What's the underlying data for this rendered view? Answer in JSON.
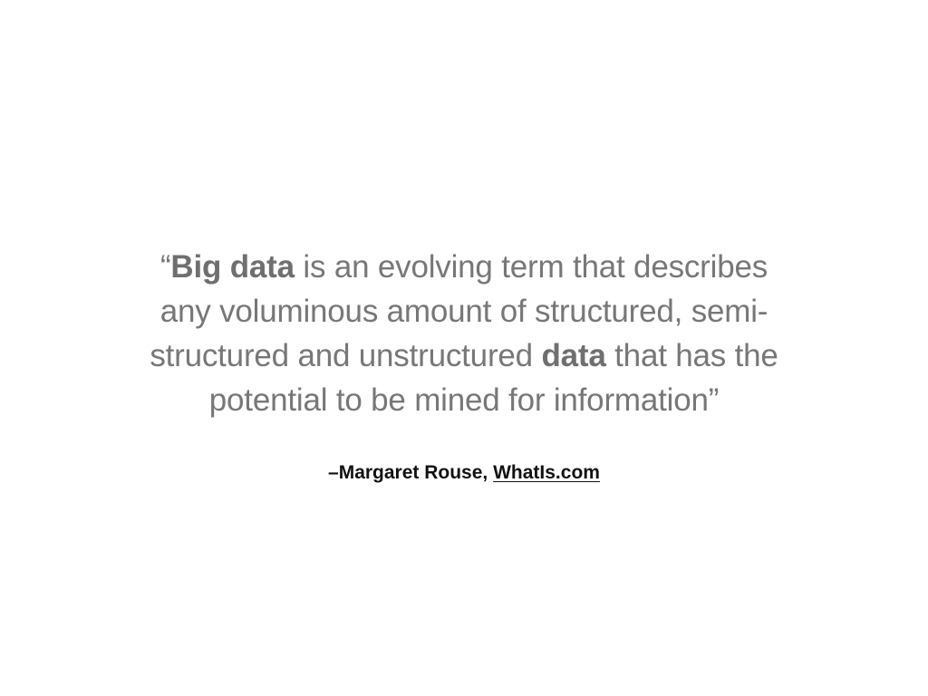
{
  "quote": {
    "line1": {
      "open_mark": "“",
      "bold": "Big data",
      "rest": " is an evolving term that describes"
    },
    "line2": "any voluminous amount of structured, semi-",
    "line3": {
      "before": "structured and unstructured ",
      "bold": "data",
      "after": " that has the"
    },
    "line4": "potential to be mined for information”"
  },
  "attribution": {
    "author": "–Margaret Rouse, ",
    "source_link": "WhatIs.com"
  }
}
